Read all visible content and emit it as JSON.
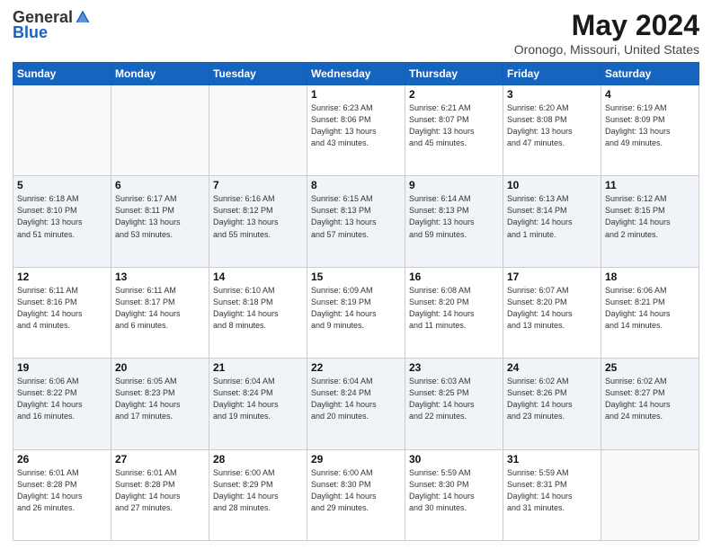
{
  "header": {
    "logo_general": "General",
    "logo_blue": "Blue",
    "title": "May 2024",
    "subtitle": "Oronogo, Missouri, United States"
  },
  "weekdays": [
    "Sunday",
    "Monday",
    "Tuesday",
    "Wednesday",
    "Thursday",
    "Friday",
    "Saturday"
  ],
  "weeks": [
    [
      {
        "day": "",
        "info": ""
      },
      {
        "day": "",
        "info": ""
      },
      {
        "day": "",
        "info": ""
      },
      {
        "day": "1",
        "info": "Sunrise: 6:23 AM\nSunset: 8:06 PM\nDaylight: 13 hours\nand 43 minutes."
      },
      {
        "day": "2",
        "info": "Sunrise: 6:21 AM\nSunset: 8:07 PM\nDaylight: 13 hours\nand 45 minutes."
      },
      {
        "day": "3",
        "info": "Sunrise: 6:20 AM\nSunset: 8:08 PM\nDaylight: 13 hours\nand 47 minutes."
      },
      {
        "day": "4",
        "info": "Sunrise: 6:19 AM\nSunset: 8:09 PM\nDaylight: 13 hours\nand 49 minutes."
      }
    ],
    [
      {
        "day": "5",
        "info": "Sunrise: 6:18 AM\nSunset: 8:10 PM\nDaylight: 13 hours\nand 51 minutes."
      },
      {
        "day": "6",
        "info": "Sunrise: 6:17 AM\nSunset: 8:11 PM\nDaylight: 13 hours\nand 53 minutes."
      },
      {
        "day": "7",
        "info": "Sunrise: 6:16 AM\nSunset: 8:12 PM\nDaylight: 13 hours\nand 55 minutes."
      },
      {
        "day": "8",
        "info": "Sunrise: 6:15 AM\nSunset: 8:13 PM\nDaylight: 13 hours\nand 57 minutes."
      },
      {
        "day": "9",
        "info": "Sunrise: 6:14 AM\nSunset: 8:13 PM\nDaylight: 13 hours\nand 59 minutes."
      },
      {
        "day": "10",
        "info": "Sunrise: 6:13 AM\nSunset: 8:14 PM\nDaylight: 14 hours\nand 1 minute."
      },
      {
        "day": "11",
        "info": "Sunrise: 6:12 AM\nSunset: 8:15 PM\nDaylight: 14 hours\nand 2 minutes."
      }
    ],
    [
      {
        "day": "12",
        "info": "Sunrise: 6:11 AM\nSunset: 8:16 PM\nDaylight: 14 hours\nand 4 minutes."
      },
      {
        "day": "13",
        "info": "Sunrise: 6:11 AM\nSunset: 8:17 PM\nDaylight: 14 hours\nand 6 minutes."
      },
      {
        "day": "14",
        "info": "Sunrise: 6:10 AM\nSunset: 8:18 PM\nDaylight: 14 hours\nand 8 minutes."
      },
      {
        "day": "15",
        "info": "Sunrise: 6:09 AM\nSunset: 8:19 PM\nDaylight: 14 hours\nand 9 minutes."
      },
      {
        "day": "16",
        "info": "Sunrise: 6:08 AM\nSunset: 8:20 PM\nDaylight: 14 hours\nand 11 minutes."
      },
      {
        "day": "17",
        "info": "Sunrise: 6:07 AM\nSunset: 8:20 PM\nDaylight: 14 hours\nand 13 minutes."
      },
      {
        "day": "18",
        "info": "Sunrise: 6:06 AM\nSunset: 8:21 PM\nDaylight: 14 hours\nand 14 minutes."
      }
    ],
    [
      {
        "day": "19",
        "info": "Sunrise: 6:06 AM\nSunset: 8:22 PM\nDaylight: 14 hours\nand 16 minutes."
      },
      {
        "day": "20",
        "info": "Sunrise: 6:05 AM\nSunset: 8:23 PM\nDaylight: 14 hours\nand 17 minutes."
      },
      {
        "day": "21",
        "info": "Sunrise: 6:04 AM\nSunset: 8:24 PM\nDaylight: 14 hours\nand 19 minutes."
      },
      {
        "day": "22",
        "info": "Sunrise: 6:04 AM\nSunset: 8:24 PM\nDaylight: 14 hours\nand 20 minutes."
      },
      {
        "day": "23",
        "info": "Sunrise: 6:03 AM\nSunset: 8:25 PM\nDaylight: 14 hours\nand 22 minutes."
      },
      {
        "day": "24",
        "info": "Sunrise: 6:02 AM\nSunset: 8:26 PM\nDaylight: 14 hours\nand 23 minutes."
      },
      {
        "day": "25",
        "info": "Sunrise: 6:02 AM\nSunset: 8:27 PM\nDaylight: 14 hours\nand 24 minutes."
      }
    ],
    [
      {
        "day": "26",
        "info": "Sunrise: 6:01 AM\nSunset: 8:28 PM\nDaylight: 14 hours\nand 26 minutes."
      },
      {
        "day": "27",
        "info": "Sunrise: 6:01 AM\nSunset: 8:28 PM\nDaylight: 14 hours\nand 27 minutes."
      },
      {
        "day": "28",
        "info": "Sunrise: 6:00 AM\nSunset: 8:29 PM\nDaylight: 14 hours\nand 28 minutes."
      },
      {
        "day": "29",
        "info": "Sunrise: 6:00 AM\nSunset: 8:30 PM\nDaylight: 14 hours\nand 29 minutes."
      },
      {
        "day": "30",
        "info": "Sunrise: 5:59 AM\nSunset: 8:30 PM\nDaylight: 14 hours\nand 30 minutes."
      },
      {
        "day": "31",
        "info": "Sunrise: 5:59 AM\nSunset: 8:31 PM\nDaylight: 14 hours\nand 31 minutes."
      },
      {
        "day": "",
        "info": ""
      }
    ]
  ]
}
